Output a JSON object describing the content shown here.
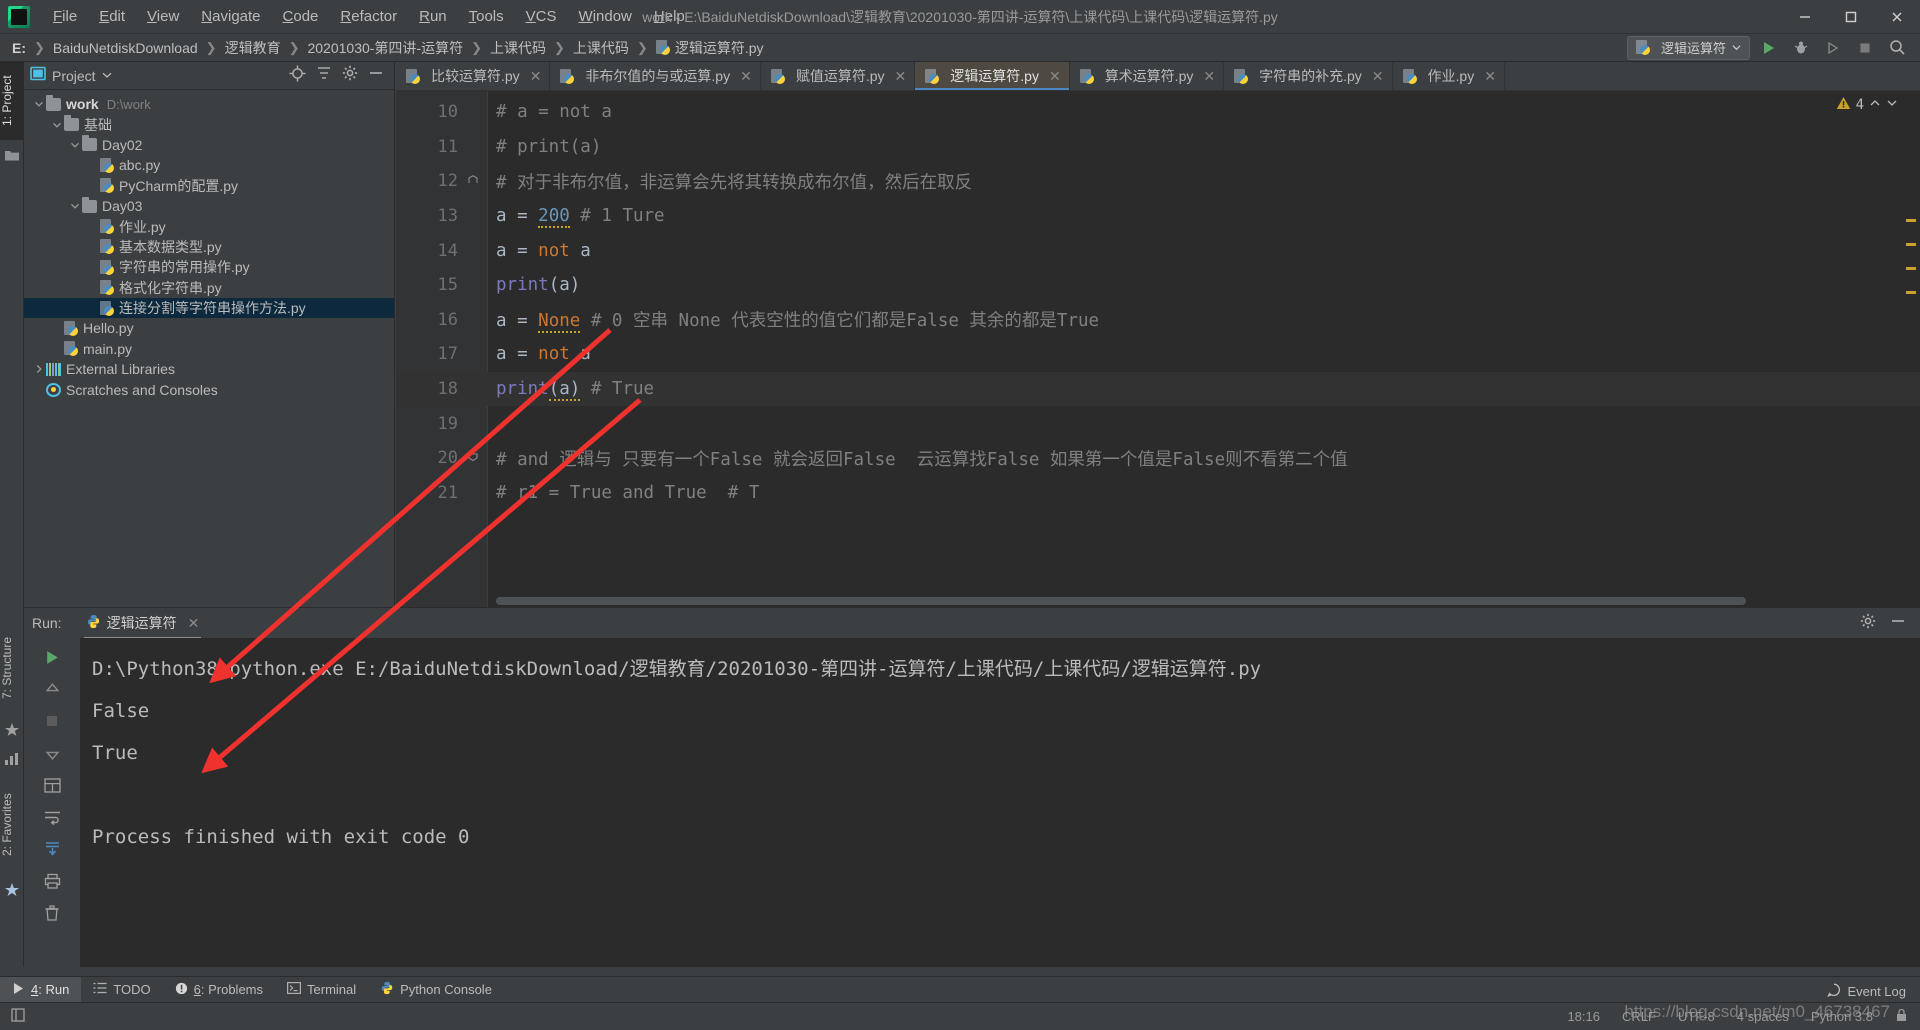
{
  "app": {
    "logo_icon": "pycharm-logo-icon",
    "window_title": "work - E:\\BaiduNetdiskDownload\\逻辑教育\\20201030-第四讲-运算符\\上课代码\\上课代码\\逻辑运算符.py",
    "accent": "#4a88c7",
    "bg": "#3c3f41",
    "editor_bg": "#2b2b2b"
  },
  "menu": [
    {
      "label": "File"
    },
    {
      "label": "Edit"
    },
    {
      "label": "View"
    },
    {
      "label": "Navigate"
    },
    {
      "label": "Code"
    },
    {
      "label": "Refactor"
    },
    {
      "label": "Run"
    },
    {
      "label": "Tools"
    },
    {
      "label": "VCS"
    },
    {
      "label": "Window"
    },
    {
      "label": "Help"
    }
  ],
  "window_controls": [
    {
      "name": "minimize-button",
      "glyph": "minimize-icon"
    },
    {
      "name": "maximize-button",
      "glyph": "maximize-icon"
    },
    {
      "name": "close-button",
      "glyph": "close-icon"
    }
  ],
  "breadcrumb": {
    "items": [
      {
        "label": "E:",
        "bold": true,
        "icon": null
      },
      {
        "label": "BaiduNetdiskDownload",
        "icon": null
      },
      {
        "label": "逻辑教育",
        "icon": null
      },
      {
        "label": "20201030-第四讲-运算符",
        "icon": null
      },
      {
        "label": "上课代码",
        "icon": null
      },
      {
        "label": "上课代码",
        "icon": null
      },
      {
        "label": "逻辑运算符.py",
        "icon": "python-file-icon"
      }
    ],
    "separator": "❯"
  },
  "navbar_right": {
    "run_config": "逻辑运算符",
    "run_config_icon": "python-file-icon",
    "dropdown_icon": "chevron-down-icon",
    "buttons": [
      {
        "name": "run-button",
        "icon": "run-play-icon",
        "color": "#59a869"
      },
      {
        "name": "debug-button",
        "icon": "debug-bug-icon",
        "color": "#a8a8a8"
      },
      {
        "name": "run-with-coverage-button",
        "icon": "coverage-icon",
        "color": "#8a8a8a"
      },
      {
        "name": "stop-button",
        "icon": "stop-square-icon",
        "color": "#8a8a8a"
      },
      {
        "name": "search-everywhere-button",
        "icon": "search-icon",
        "color": "#b0b0b0"
      }
    ]
  },
  "left_strip": [
    {
      "label": "1: Project",
      "active": true
    },
    {
      "label": "7: Structure",
      "active": false
    },
    {
      "label": "2: Favorites",
      "active": false
    }
  ],
  "project_panel": {
    "title": "Project",
    "title_icon": "project-view-icon",
    "dropdown_icon": "chevron-down-icon",
    "header_buttons": [
      {
        "name": "scroll-from-source-button",
        "icon": "target-icon"
      },
      {
        "name": "collapse-all-button",
        "icon": "collapse-all-icon"
      },
      {
        "name": "settings-button",
        "icon": "gear-icon"
      },
      {
        "name": "hide-panel-button",
        "icon": "minimize-icon"
      }
    ],
    "tree": [
      {
        "indent": 0,
        "chev": "down",
        "icon": "folder-icon",
        "label": "work",
        "bold": true,
        "sub": "D:\\work",
        "selected": false
      },
      {
        "indent": 1,
        "chev": "down",
        "icon": "folder-icon",
        "label": "基础",
        "bold": false,
        "sub": "",
        "selected": false
      },
      {
        "indent": 2,
        "chev": "down",
        "icon": "folder-icon",
        "label": "Day02",
        "bold": false,
        "sub": "",
        "selected": false
      },
      {
        "indent": 3,
        "chev": "none",
        "icon": "python-file-icon",
        "label": "abc.py",
        "bold": false,
        "sub": "",
        "selected": false
      },
      {
        "indent": 3,
        "chev": "none",
        "icon": "python-file-icon",
        "label": "PyCharm的配置.py",
        "bold": false,
        "sub": "",
        "selected": false
      },
      {
        "indent": 2,
        "chev": "down",
        "icon": "folder-icon",
        "label": "Day03",
        "bold": false,
        "sub": "",
        "selected": false
      },
      {
        "indent": 3,
        "chev": "none",
        "icon": "python-file-icon",
        "label": "作业.py",
        "bold": false,
        "sub": "",
        "selected": false
      },
      {
        "indent": 3,
        "chev": "none",
        "icon": "python-file-icon",
        "label": "基本数据类型.py",
        "bold": false,
        "sub": "",
        "selected": false
      },
      {
        "indent": 3,
        "chev": "none",
        "icon": "python-file-icon",
        "label": "字符串的常用操作.py",
        "bold": false,
        "sub": "",
        "selected": false
      },
      {
        "indent": 3,
        "chev": "none",
        "icon": "python-file-icon",
        "label": "格式化字符串.py",
        "bold": false,
        "sub": "",
        "selected": false
      },
      {
        "indent": 3,
        "chev": "none",
        "icon": "python-file-icon",
        "label": "连接分割等字符串操作方法.py",
        "bold": false,
        "sub": "",
        "selected": true
      },
      {
        "indent": 1,
        "chev": "none",
        "icon": "python-file-icon",
        "label": "Hello.py",
        "bold": false,
        "sub": "",
        "selected": false
      },
      {
        "indent": 1,
        "chev": "none",
        "icon": "python-file-icon",
        "label": "main.py",
        "bold": false,
        "sub": "",
        "selected": false
      },
      {
        "indent": 0,
        "chev": "right",
        "icon": "external-libraries-icon",
        "label": "External Libraries",
        "bold": false,
        "sub": "",
        "selected": false
      },
      {
        "indent": 0,
        "chev": "none",
        "icon": "scratches-icon",
        "label": "Scratches and Consoles",
        "bold": false,
        "sub": "",
        "selected": false
      }
    ]
  },
  "editor": {
    "tabs": [
      {
        "label": "比较运算符.py",
        "active": false
      },
      {
        "label": "非布尔值的与或运算.py",
        "active": false
      },
      {
        "label": "赋值运算符.py",
        "active": false
      },
      {
        "label": "逻辑运算符.py",
        "active": true
      },
      {
        "label": "算术运算符.py",
        "active": false
      },
      {
        "label": "字符串的补充.py",
        "active": false
      },
      {
        "label": "作业.py",
        "active": false
      }
    ],
    "tab_icon": "python-file-icon",
    "close_icon": "close-icon",
    "warning_count": "4",
    "warning_icon": "warning-triangle-icon",
    "up_icon": "chevron-up-icon",
    "down_icon": "chevron-down-icon",
    "lines": [
      {
        "num": "10",
        "fold": "",
        "tokens": [
          {
            "t": "# a = not a",
            "c": "cmt"
          }
        ]
      },
      {
        "num": "11",
        "fold": "",
        "tokens": [
          {
            "t": "# print(a)",
            "c": "cmt"
          }
        ]
      },
      {
        "num": "12",
        "fold": "fold-end",
        "tokens": [
          {
            "t": "# 对于非布尔值，非运算会先将其转换成布尔值，然后在取反",
            "c": "cmt"
          }
        ]
      },
      {
        "num": "13",
        "fold": "",
        "tokens": [
          {
            "t": "a = ",
            "c": "plain"
          },
          {
            "t": "200",
            "c": "num squig"
          },
          {
            "t": " # 1 Ture",
            "c": "cmt"
          }
        ]
      },
      {
        "num": "14",
        "fold": "",
        "tokens": [
          {
            "t": "a = ",
            "c": "plain"
          },
          {
            "t": "not",
            "c": "kw"
          },
          {
            "t": " a",
            "c": "plain"
          }
        ]
      },
      {
        "num": "15",
        "fold": "",
        "tokens": [
          {
            "t": "print",
            "c": "fn"
          },
          {
            "t": "(a)",
            "c": "plain"
          }
        ]
      },
      {
        "num": "16",
        "fold": "",
        "tokens": [
          {
            "t": "a = ",
            "c": "plain"
          },
          {
            "t": "None",
            "c": "kw squig"
          },
          {
            "t": " # 0 空串 None 代表空性的值它们都是False 其余的都是True",
            "c": "cmt"
          }
        ]
      },
      {
        "num": "17",
        "fold": "",
        "tokens": [
          {
            "t": "a = ",
            "c": "plain"
          },
          {
            "t": "not",
            "c": "kw"
          },
          {
            "t": " a",
            "c": "plain"
          }
        ]
      },
      {
        "num": "18",
        "fold": "",
        "tokens": [
          {
            "t": "print",
            "c": "fn"
          },
          {
            "t": "(a)",
            "c": "plain squig"
          },
          {
            "t": " # True",
            "c": "cmt"
          }
        ]
      },
      {
        "num": "19",
        "fold": "",
        "tokens": [
          {
            "t": "",
            "c": "plain"
          }
        ]
      },
      {
        "num": "20",
        "fold": "fold-start",
        "tokens": [
          {
            "t": "# and 逻辑与 只要有一个False 就会返回False  云运算找False 如果第一个值是False则不看第二个值",
            "c": "cmt"
          }
        ]
      },
      {
        "num": "21",
        "fold": "",
        "tokens": [
          {
            "t": "# r1 = True and True  # T",
            "c": "cmt"
          }
        ]
      }
    ]
  },
  "run_panel": {
    "label": "Run:",
    "tab_label": "逻辑运算符",
    "tab_icon": "python-icon",
    "close_icon": "close-icon",
    "header_buttons": [
      {
        "name": "run-settings-button",
        "icon": "gear-icon"
      },
      {
        "name": "hide-run-panel-button",
        "icon": "minimize-icon"
      }
    ],
    "toolbar": [
      {
        "name": "rerun-button",
        "icon": "run-play-icon",
        "color": "#59a869"
      },
      {
        "name": "scroll-up-button",
        "icon": "arrow-up-icon",
        "color": "#8a8a8a"
      },
      {
        "name": "stop-button",
        "icon": "stop-square-icon",
        "color": "#6e6e6e"
      },
      {
        "name": "scroll-down-button",
        "icon": "arrow-down-icon",
        "color": "#8a8a8a"
      },
      {
        "name": "toggle-tasks-button",
        "icon": "grid-icon",
        "color": "#a0a0a0"
      },
      {
        "name": "soft-wrap-button",
        "icon": "wrap-text-icon",
        "color": "#a0a0a0"
      },
      {
        "name": "scroll-to-end-button",
        "icon": "scroll-end-icon",
        "color": "#4a88c7"
      },
      {
        "name": "print-button",
        "icon": "printer-icon",
        "color": "#a0a0a0"
      },
      {
        "name": "clear-all-button",
        "icon": "trash-icon",
        "color": "#a0a0a0"
      }
    ],
    "console_lines": [
      "D:\\Python38\\python.exe E:/BaiduNetdiskDownload/逻辑教育/20201030-第四讲-运算符/上课代码/上课代码/逻辑运算符.py",
      "False",
      "True",
      "",
      "Process finished with exit code 0"
    ]
  },
  "bottom_bar": [
    {
      "label": "4: Run",
      "icon": "run-play-icon",
      "active": true,
      "mnemonic": "4"
    },
    {
      "label": "TODO",
      "icon": "todo-list-icon",
      "active": false,
      "mnemonic": ""
    },
    {
      "label": "6: Problems",
      "icon": "problems-icon",
      "active": false,
      "mnemonic": "6"
    },
    {
      "label": "Terminal",
      "icon": "terminal-icon",
      "active": false,
      "mnemonic": ""
    },
    {
      "label": "Python Console",
      "icon": "python-icon",
      "active": false,
      "mnemonic": ""
    }
  ],
  "status_bar": {
    "left_icon": "toggle-toolwindows-icon",
    "event_log": "Event Log",
    "event_log_icon": "event-log-icon",
    "items": [
      {
        "name": "status-time",
        "label": "18:16"
      },
      {
        "name": "status-line-separator",
        "label": "CRLF"
      },
      {
        "name": "status-encoding",
        "label": "UTF-8"
      },
      {
        "name": "status-indent",
        "label": "4 spaces"
      },
      {
        "name": "status-interpreter",
        "label": "Python 3.8"
      },
      {
        "name": "status-lock",
        "label": ""
      }
    ]
  },
  "watermark": "https://blog.csdn.net/m0_46738467"
}
